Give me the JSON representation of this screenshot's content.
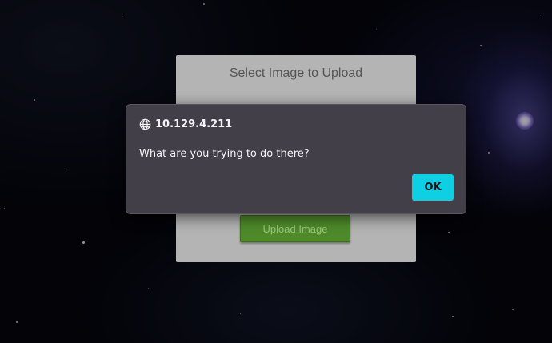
{
  "upload_card": {
    "title": "Select Image to Upload",
    "button_label": "Upload Image"
  },
  "alert": {
    "origin": "10.129.4.211",
    "origin_icon": "globe-icon",
    "message": "What are you trying to do there?",
    "ok_label": "OK"
  },
  "colors": {
    "ok_button": "#0fcfe3",
    "dialog_bg": "#423f49",
    "upload_button": "#4e8a2a"
  }
}
